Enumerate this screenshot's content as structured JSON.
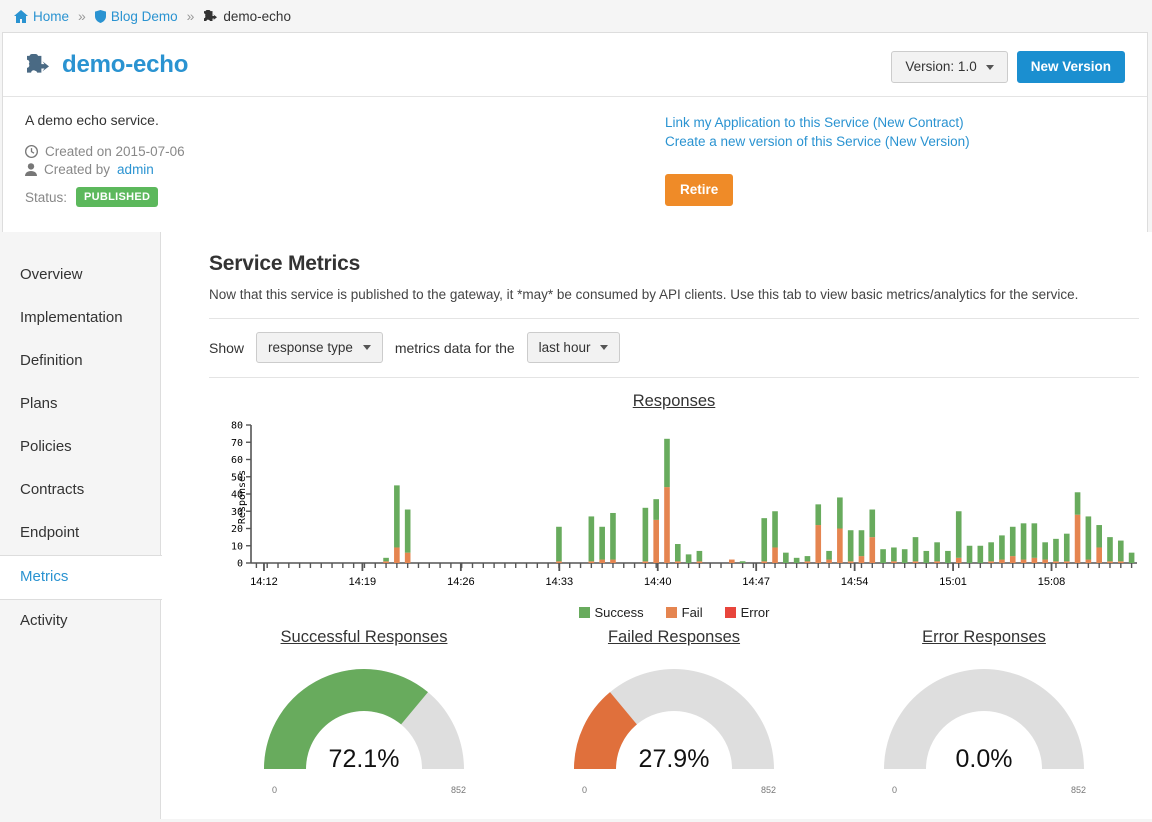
{
  "breadcrumb": {
    "items": [
      {
        "label": "Home",
        "icon": "home-icon"
      },
      {
        "label": "Blog Demo",
        "icon": "shield-icon"
      },
      {
        "label": "demo-echo",
        "icon": "puzzle-icon"
      }
    ],
    "separator": "»"
  },
  "service": {
    "name": "demo-echo",
    "description": "A demo echo service.",
    "created_on_label": "Created on 2015-07-06",
    "created_by_prefix": "Created by",
    "created_by_user": "admin",
    "status_label": "Status:",
    "status_value": "PUBLISHED",
    "version_button": "Version: 1.0",
    "new_version_button": "New Version",
    "link_app_link": "Link my Application to this Service (New Contract)",
    "new_version_link": "Create a new version of this Service (New Version)",
    "retire_button": "Retire"
  },
  "sidebar": {
    "items": [
      {
        "label": "Overview",
        "active": false
      },
      {
        "label": "Implementation",
        "active": false
      },
      {
        "label": "Definition",
        "active": false
      },
      {
        "label": "Plans",
        "active": false
      },
      {
        "label": "Policies",
        "active": false
      },
      {
        "label": "Contracts",
        "active": false
      },
      {
        "label": "Endpoint",
        "active": false
      },
      {
        "label": "Metrics",
        "active": true
      },
      {
        "label": "Activity",
        "active": false
      }
    ]
  },
  "main": {
    "title": "Service Metrics",
    "description": "Now that this service is published to the gateway, it *may* be consumed by API clients. Use this tab to view basic metrics/analytics for the service.",
    "filter": {
      "show_label": "Show",
      "type_select_value": "response type",
      "middle_label": "metrics data for the",
      "period_select_value": "last hour"
    }
  },
  "chart_data": [
    {
      "type": "bar",
      "title": "Responses",
      "stacked": true,
      "xlabel": "",
      "ylabel": "Responses",
      "ylim": [
        0,
        80
      ],
      "yticks": [
        0,
        10,
        20,
        30,
        40,
        50,
        60,
        70,
        80
      ],
      "xticks": [
        "14:12",
        "14:19",
        "14:26",
        "14:33",
        "14:40",
        "14:47",
        "14:54",
        "15:01",
        "15:08"
      ],
      "grid": false,
      "legend": [
        "Success",
        "Fail",
        "Error"
      ],
      "legend_position": "bottom",
      "colors": {
        "Success": "#68ab5d",
        "Fail": "#e58550",
        "Error": "#e8453c"
      },
      "series": [
        {
          "name": "Fail",
          "values": [
            0,
            0,
            0,
            0,
            0,
            0,
            0,
            0,
            0,
            0,
            0,
            0,
            1,
            9,
            6,
            0,
            0,
            0,
            0,
            0,
            0,
            0,
            0,
            0,
            0,
            0,
            0,
            0,
            1,
            0,
            0,
            1,
            2,
            2,
            0,
            0,
            1,
            25,
            44,
            1,
            0,
            1,
            0,
            0,
            2,
            0,
            0,
            1,
            9,
            0,
            0,
            1,
            22,
            2,
            20,
            1,
            4,
            15,
            0,
            1,
            0,
            1,
            0,
            1,
            0,
            3,
            0,
            0,
            1,
            2,
            4,
            2,
            3,
            2,
            1,
            1,
            28,
            2,
            9,
            1,
            1,
            0
          ]
        },
        {
          "name": "Success",
          "values": [
            0,
            0,
            0,
            0,
            0,
            0,
            0,
            0,
            0,
            0,
            0,
            0,
            2,
            36,
            25,
            0,
            0,
            0,
            0,
            0,
            0,
            0,
            0,
            0,
            0,
            0,
            0,
            0,
            20,
            0,
            0,
            26,
            19,
            27,
            0,
            0,
            31,
            12,
            28,
            10,
            5,
            6,
            0,
            0,
            0,
            1,
            0,
            25,
            21,
            6,
            3,
            3,
            12,
            5,
            18,
            18,
            15,
            16,
            8,
            8,
            8,
            14,
            7,
            11,
            7,
            27,
            10,
            10,
            11,
            14,
            17,
            21,
            20,
            10,
            13,
            16,
            13,
            25,
            13,
            14,
            12,
            6
          ]
        },
        {
          "name": "Error",
          "values": [
            0,
            0,
            0,
            0,
            0,
            0,
            0,
            0,
            0,
            0,
            0,
            0,
            0,
            0,
            0,
            0,
            0,
            0,
            0,
            0,
            0,
            0,
            0,
            0,
            0,
            0,
            0,
            0,
            0,
            0,
            0,
            0,
            0,
            0,
            0,
            0,
            0,
            0,
            0,
            0,
            0,
            0,
            0,
            0,
            0,
            0,
            0,
            0,
            0,
            0,
            0,
            0,
            0,
            0,
            0,
            0,
            0,
            0,
            0,
            0,
            0,
            0,
            0,
            0,
            0,
            0,
            0,
            0,
            0,
            0,
            0,
            0,
            0,
            0,
            0,
            0,
            0,
            0,
            0,
            0,
            0,
            0
          ]
        }
      ]
    },
    {
      "type": "gauge",
      "title": "Successful Responses",
      "value_label": "72.1%",
      "percent": 72.1,
      "min_label": "0",
      "max_label": "852",
      "color": "#68ab5d"
    },
    {
      "type": "gauge",
      "title": "Failed Responses",
      "value_label": "27.9%",
      "percent": 27.9,
      "min_label": "0",
      "max_label": "852",
      "color": "#e0703c"
    },
    {
      "type": "gauge",
      "title": "Error Responses",
      "value_label": "0.0%",
      "percent": 0.0,
      "min_label": "0",
      "max_label": "852",
      "color": "#e8453c"
    }
  ]
}
